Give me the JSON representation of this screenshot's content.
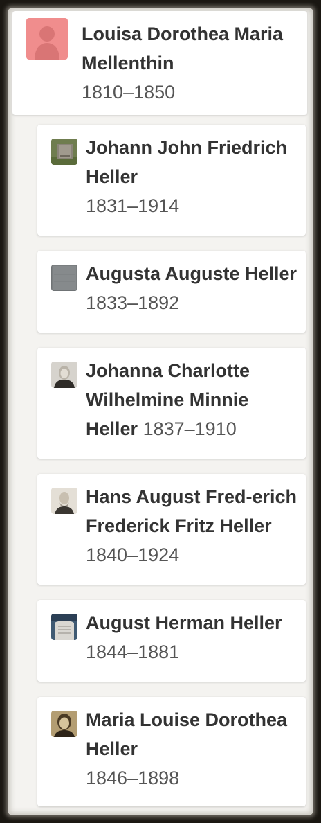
{
  "parent": {
    "name": "Louisa Dorothea Maria Mellenthin",
    "dates": "1810–1850",
    "avatar": "female-silhouette-icon"
  },
  "children": [
    {
      "name": "Johann John Friedrich Heller",
      "dates": "1831–1914",
      "avatar": "gravestone-photo"
    },
    {
      "name": "Augusta Auguste Heller",
      "dates": "1833–1892",
      "avatar": "gray-stone-photo"
    },
    {
      "name": "Johanna Charlotte Wilhelmine Minnie Heller",
      "dates": "1837–1910",
      "avatar": "woman-portrait-photo"
    },
    {
      "name": "Hans August Fred-erich Frederick Fritz Heller",
      "dates": "1840–1924",
      "avatar": "man-portrait-photo"
    },
    {
      "name": "August Herman Heller",
      "dates": "1844–1881",
      "avatar": "headstone-photo"
    },
    {
      "name": "Maria Louise Dorothea Heller",
      "dates": "1846–1898",
      "avatar": "woman-portrait-sepia-photo"
    }
  ],
  "colors": {
    "female_silhouette_bg": "#f08d8d",
    "text_primary": "#333333",
    "text_dates": "#555555"
  }
}
